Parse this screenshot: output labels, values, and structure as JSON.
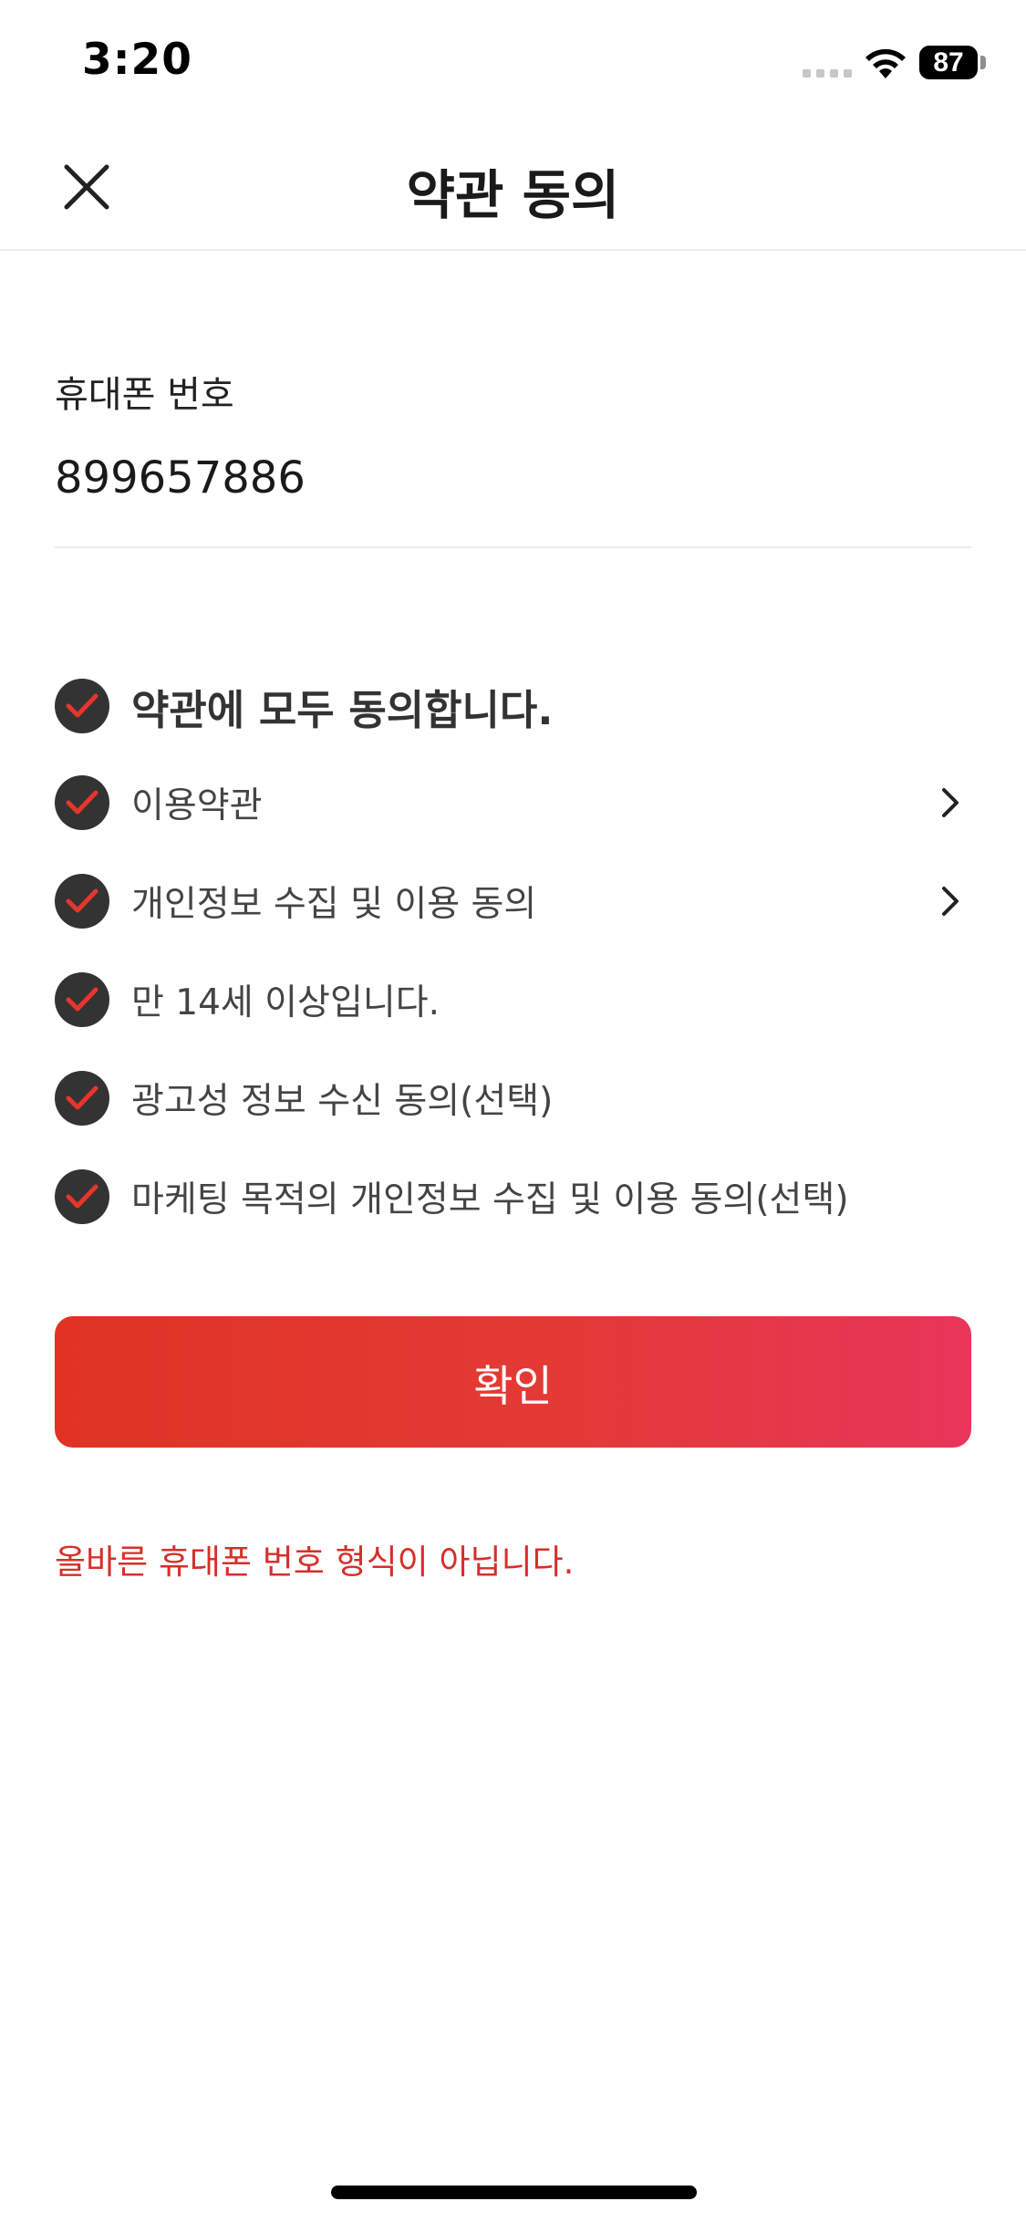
{
  "status_bar": {
    "time": "3:20",
    "battery_level": "87"
  },
  "header": {
    "title": "약관 동의",
    "close_icon": "close-icon"
  },
  "phone": {
    "label": "휴대폰 번호",
    "value": "899657886",
    "placeholder": ""
  },
  "agreements": {
    "all_label": "약관에 모두 동의합니다.",
    "items": [
      {
        "label": "이용약관",
        "checked": true,
        "has_detail": true
      },
      {
        "label": "개인정보 수집 및 이용 동의",
        "checked": true,
        "has_detail": true
      },
      {
        "label": "만 14세 이상입니다.",
        "checked": true,
        "has_detail": false
      },
      {
        "label": "광고성 정보 수신 동의(선택)",
        "checked": true,
        "has_detail": false
      },
      {
        "label": "마케팅 목적의 개인정보 수집 및 이용 동의(선택)",
        "checked": true,
        "has_detail": false
      }
    ]
  },
  "confirm_label": "확인",
  "error_message": "올바른 휴대폰 번호 형식이 아닙니다.",
  "colors": {
    "accent_red": "#E03324",
    "accent_pink": "#E8355A",
    "check_bg": "#333333",
    "check_mark": "#E8352B",
    "error_text": "#D62F2A"
  }
}
